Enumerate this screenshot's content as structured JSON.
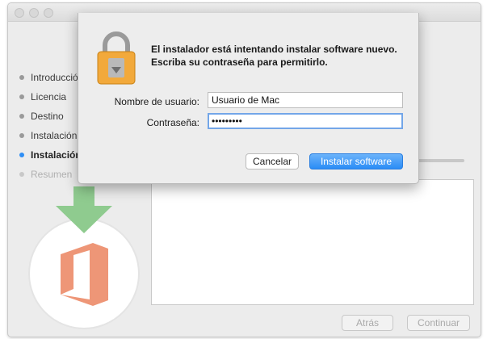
{
  "installer": {
    "steps": [
      {
        "label": "Introducción",
        "state": "done"
      },
      {
        "label": "Licencia",
        "state": "done"
      },
      {
        "label": "Destino",
        "state": "done"
      },
      {
        "label": "Instalación",
        "state": "done"
      },
      {
        "label": "Instalación",
        "state": "current"
      },
      {
        "label": "Resumen",
        "state": "future"
      }
    ],
    "back_label": "Atrás",
    "continue_label": "Continuar"
  },
  "dialog": {
    "message": "El instalador está intentando instalar software nuevo. Escriba su contraseña para permitirlo.",
    "username_label": "Nombre de usuario:",
    "username_value": "Usuario de Mac",
    "password_label": "Contraseña:",
    "password_value": "secreto99",
    "cancel_label": "Cancelar",
    "confirm_label": "Instalar software"
  },
  "icons": {
    "lock": "lock-icon",
    "arrow": "download-arrow-icon",
    "app": "office-icon"
  },
  "colors": {
    "accent": "#2a8cf6",
    "current_step": "#2f8ef5",
    "arrow": "#8fcb8f",
    "office": "#ee9677"
  }
}
